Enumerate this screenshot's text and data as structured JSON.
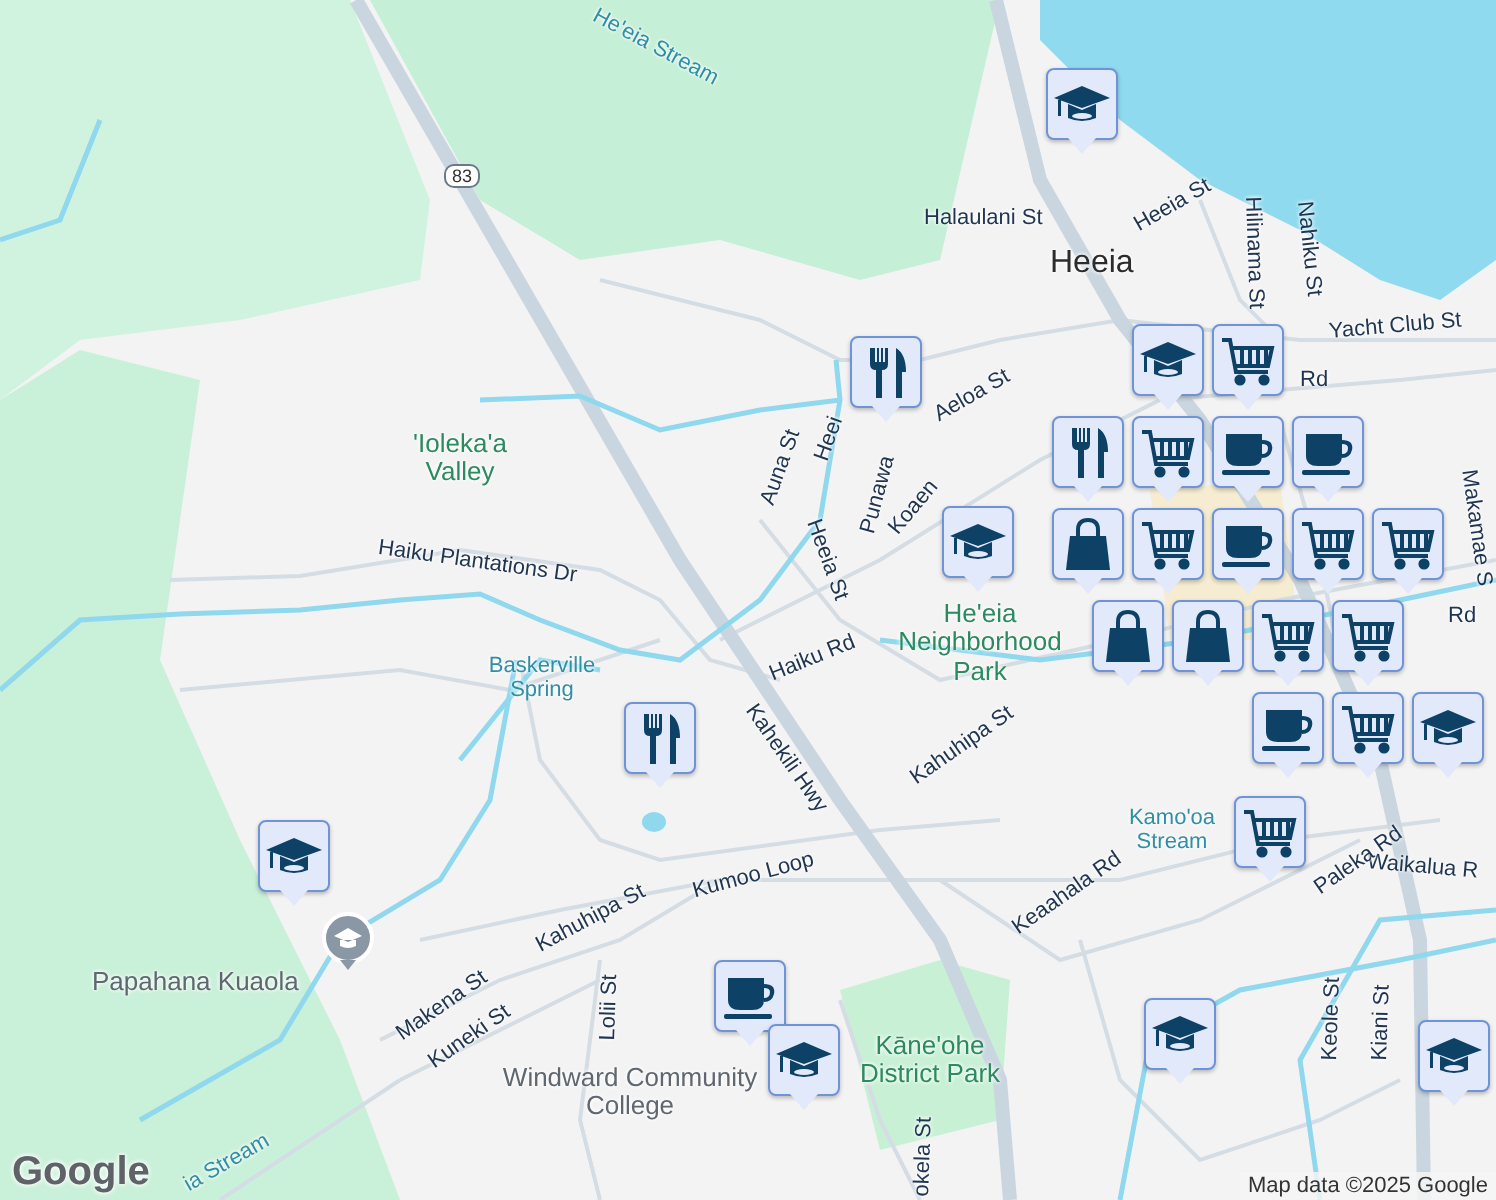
{
  "labels": [
    {
      "text": "He'eia Stream",
      "kind": "water"
    },
    {
      "text": "83",
      "kind": "shield"
    },
    {
      "text": "Halaulani St",
      "kind": "road"
    },
    {
      "text": "Heeia",
      "kind": "town"
    },
    {
      "text": "Heeia St",
      "kind": "road"
    },
    {
      "text": "Hilinama St",
      "kind": "road"
    },
    {
      "text": "Nahiku St",
      "kind": "road"
    },
    {
      "text": "Yacht Club St",
      "kind": "road"
    },
    {
      "text": "Rd",
      "kind": "road"
    },
    {
      "text": "Aeloa St",
      "kind": "road"
    },
    {
      "text": "Heei",
      "kind": "road"
    },
    {
      "text": "Punawa",
      "kind": "road"
    },
    {
      "text": "Auna St",
      "kind": "road"
    },
    {
      "text": "Heeia St",
      "kind": "road"
    },
    {
      "text": "Koaen",
      "kind": "road"
    },
    {
      "text": "'Ioleka'a Valley",
      "kind": "park"
    },
    {
      "text": "Haiku Plantations Dr",
      "kind": "road"
    },
    {
      "text": "Baskerville Spring",
      "kind": "water"
    },
    {
      "text": "Haiku Rd",
      "kind": "road"
    },
    {
      "text": "He'eia Neighborhood Park",
      "kind": "park"
    },
    {
      "text": "Rd",
      "kind": "road"
    },
    {
      "text": "Makamae S",
      "kind": "road"
    },
    {
      "text": "Kahekili Hwy",
      "kind": "road"
    },
    {
      "text": "Kahuhipa St",
      "kind": "road"
    },
    {
      "text": "Kumoo Loop",
      "kind": "road"
    },
    {
      "text": "Kamo'oa Stream",
      "kind": "water"
    },
    {
      "text": "Waikalua R",
      "kind": "road"
    },
    {
      "text": "Paleka Rd",
      "kind": "road"
    },
    {
      "text": "Keaahala Rd",
      "kind": "road"
    },
    {
      "text": "Kahuhipa St",
      "kind": "road"
    },
    {
      "text": "Papahana Kuaola",
      "kind": "poi"
    },
    {
      "text": "Makena St",
      "kind": "road"
    },
    {
      "text": "Kuneki St",
      "kind": "road"
    },
    {
      "text": "Lolii St",
      "kind": "road"
    },
    {
      "text": "Windward Community College",
      "kind": "poi"
    },
    {
      "text": "Kāne'ohe District Park",
      "kind": "park"
    },
    {
      "text": "okela St",
      "kind": "road"
    },
    {
      "text": "Keole St",
      "kind": "road"
    },
    {
      "text": "Kiani St",
      "kind": "road"
    },
    {
      "text": "ia Stream",
      "kind": "water"
    }
  ],
  "pins": [
    {
      "kind": "school"
    },
    {
      "kind": "school"
    },
    {
      "kind": "cart"
    },
    {
      "kind": "restaurant"
    },
    {
      "kind": "restaurant"
    },
    {
      "kind": "cart"
    },
    {
      "kind": "cafe"
    },
    {
      "kind": "cafe"
    },
    {
      "kind": "bag"
    },
    {
      "kind": "school"
    },
    {
      "kind": "bag"
    },
    {
      "kind": "cart"
    },
    {
      "kind": "cafe"
    },
    {
      "kind": "bag"
    },
    {
      "kind": "cart"
    },
    {
      "kind": "cart"
    },
    {
      "kind": "restaurant"
    },
    {
      "kind": "cart"
    },
    {
      "kind": "cart"
    },
    {
      "kind": "school"
    },
    {
      "kind": "cafe"
    },
    {
      "kind": "cart"
    },
    {
      "kind": "cart"
    },
    {
      "kind": "school"
    },
    {
      "kind": "cafe"
    },
    {
      "kind": "school"
    },
    {
      "kind": "school"
    },
    {
      "kind": "school"
    }
  ],
  "attribution": {
    "logo": "Google",
    "text": "Map data ©2025 Google"
  }
}
